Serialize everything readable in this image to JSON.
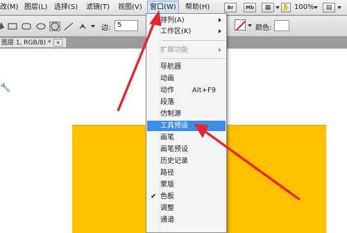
{
  "menubar": {
    "items": [
      {
        "label": "修改(M)"
      },
      {
        "label": "图层(L)"
      },
      {
        "label": "选择(S)"
      },
      {
        "label": "滤镜(T)"
      },
      {
        "label": "视图(V)"
      },
      {
        "label": "窗口(W)"
      },
      {
        "label": "帮助(H)"
      }
    ],
    "br_label": "Br",
    "mb_label": "Mb",
    "zoom": "100%"
  },
  "options": {
    "sides_label": "边:",
    "sides_value": "5",
    "color_label": "颜色:"
  },
  "document": {
    "tab_label": "图层 1, RGB/8) *",
    "close_label": "×"
  },
  "window_menu": {
    "items": [
      {
        "label": "排列(A)"
      },
      {
        "label": "工作区(K)"
      },
      {
        "label": "扩展功能"
      },
      {
        "label": "导航器"
      },
      {
        "label": "动画"
      },
      {
        "label": "动作",
        "shortcut": "Alt+F9"
      },
      {
        "label": "段落"
      },
      {
        "label": "仿制源"
      },
      {
        "label": "工具预设"
      },
      {
        "label": "画笔"
      },
      {
        "label": "画笔预设"
      },
      {
        "label": "历史记录"
      },
      {
        "label": "路径"
      },
      {
        "label": "蒙版"
      },
      {
        "label": "色板"
      },
      {
        "label": "调整"
      },
      {
        "label": "通道"
      }
    ],
    "checkmark": "✔"
  },
  "colors": {
    "artwork": "#ffc000",
    "highlight": "#3d8ee6",
    "annotation": "#e8262b"
  }
}
